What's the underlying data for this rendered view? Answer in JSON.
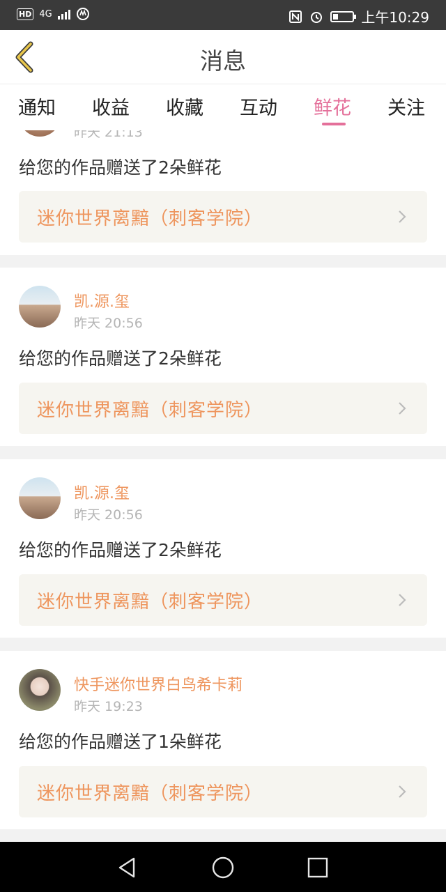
{
  "status_bar": {
    "hd": "HD",
    "network": "4G",
    "time": "上午10:29",
    "battery_level": 0.25
  },
  "header": {
    "title": "消息"
  },
  "tabs": [
    {
      "label": "通知",
      "active": false
    },
    {
      "label": "收益",
      "active": false
    },
    {
      "label": "收藏",
      "active": false
    },
    {
      "label": "互动",
      "active": false
    },
    {
      "label": "鲜花",
      "active": true
    },
    {
      "label": "关注",
      "active": false
    }
  ],
  "items": [
    {
      "user": "",
      "time": "昨天 21:13",
      "message": "给您的作品赠送了2朵鲜花",
      "work": "迷你世界离黯（刺客学院）"
    },
    {
      "user": "凯.源.玺",
      "time": "昨天 20:56",
      "message": "给您的作品赠送了2朵鲜花",
      "work": "迷你世界离黯（刺客学院）"
    },
    {
      "user": "凯.源.玺",
      "time": "昨天 20:56",
      "message": "给您的作品赠送了2朵鲜花",
      "work": "迷你世界离黯（刺客学院）"
    },
    {
      "user": "快手迷你世界白鸟希卡莉",
      "time": "昨天 19:23",
      "message": "给您的作品赠送了1朵鲜花",
      "work": "迷你世界离黯（刺客学院）"
    }
  ],
  "colors": {
    "accent": "#e4709a",
    "orange": "#ee955d",
    "back_icon": "#c9a640"
  }
}
